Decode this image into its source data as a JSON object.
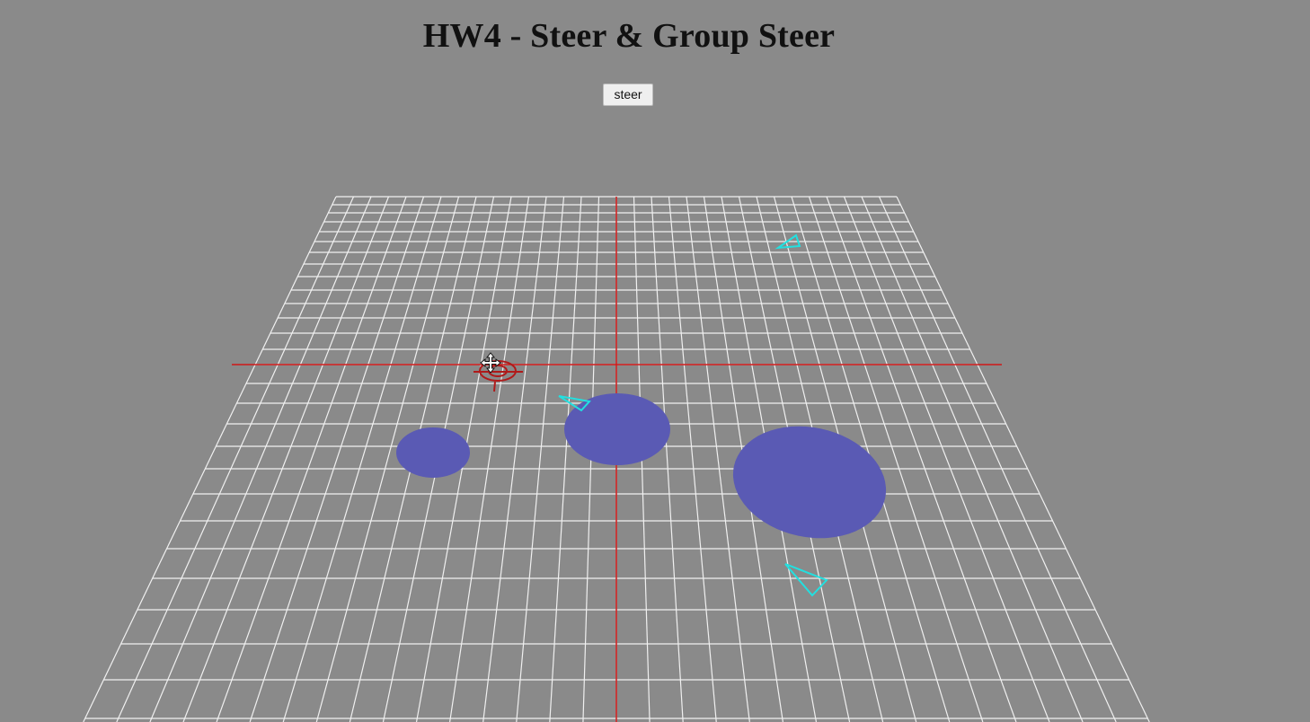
{
  "page": {
    "title": "HW4 - Steer & Group Steer"
  },
  "controls": {
    "steer_button_label": "steer"
  },
  "scene": {
    "background_color": "#8a8a8a",
    "grid_color": "#f0f0f0",
    "axis_color": "#d01818",
    "obstacle_color": "#5a5ab4",
    "agent_color": "#22e0e0",
    "target_color": "#b01a1a",
    "obstacles_count": 3,
    "agents_count": 3,
    "icons": [
      "move-cursor-icon",
      "target-crosshair-icon"
    ]
  }
}
